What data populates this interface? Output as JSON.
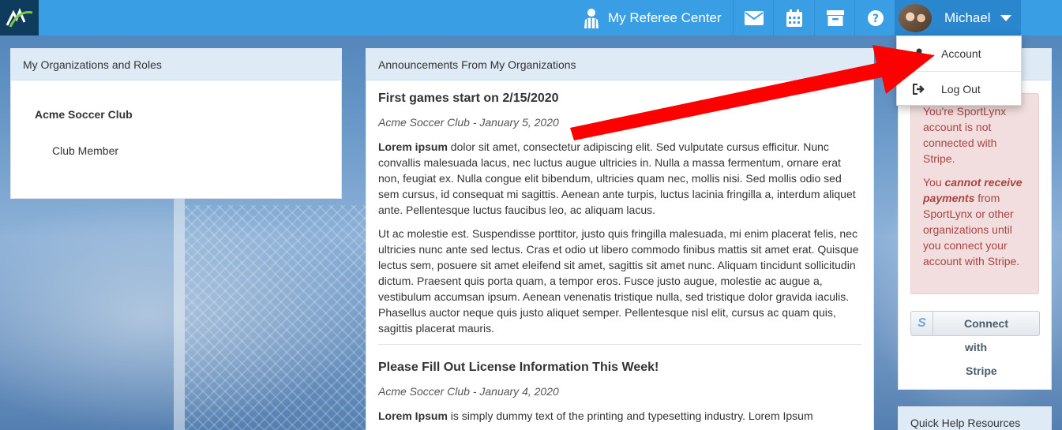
{
  "navbar": {
    "referee_center_label": "My Referee Center",
    "user_name": "Michael"
  },
  "user_menu": {
    "items": [
      {
        "label": "Account",
        "icon": "user-icon"
      },
      {
        "label": "Log Out",
        "icon": "logout-icon"
      }
    ]
  },
  "orgs_panel": {
    "title": "My Organizations and Roles",
    "organizations": [
      {
        "name": "Acme Soccer Club",
        "role": "Club Member"
      }
    ]
  },
  "announcements": {
    "title": "Announcements From My Organizations",
    "items": [
      {
        "title": "First games start on 2/15/2020",
        "meta": "Acme Soccer Club - January 5, 2020",
        "lead_bold": "Lorem ipsum",
        "p1_rest": " dolor sit amet, consectetur adipiscing elit. Sed vulputate cursus efficitur. Nunc convallis malesuada lacus, nec luctus augue ultricies in. Nulla a massa fermentum, ornare erat non, feugiat ex. Nulla congue elit bibendum, ultricies quam nec, mollis nisi. Sed mollis odio sed sem cursus, id consequat mi sagittis. Aenean ante turpis, luctus lacinia fringilla a, interdum aliquet ante. Pellentesque luctus faucibus leo, ac aliquam lacus.",
        "p2": "Ut ac molestie est. Suspendisse porttitor, justo quis fringilla malesuada, mi enim placerat felis, nec ultricies nunc ante sed lectus. Cras et odio ut libero commodo finibus mattis sit amet erat. Quisque lectus sem, posuere sit amet eleifend sit amet, sagittis sit amet nunc. Aliquam tincidunt sollicitudin dictum. Praesent quis porta quam, a tempor eros. Fusce justo augue, molestie ac augue a, vestibulum accumsan ipsum. Aenean venenatis tristique nulla, sed tristique dolor gravida iaculis. Phasellus auctor neque quis justo aliquet semper. Pellentesque nisl elit, cursus ac quam quis, sagittis placerat mauris."
      },
      {
        "title": "Please Fill Out License Information This Week!",
        "meta": "Acme Soccer Club - January 4, 2020",
        "lead_bold": "Lorem Ipsum",
        "p1_rest": " is simply dummy text of the printing and typesetting industry. Lorem Ipsum"
      }
    ]
  },
  "stripe_alert": {
    "line1": "You're SportLynx account is not connected with Stripe.",
    "line2_pre": "You ",
    "line2_emph": "cannot receive payments",
    "line2_post": " from SportLynx or other organizations until you connect your account with Stripe."
  },
  "stripe_button": {
    "word1": "Connect",
    "word2": "with",
    "word3": "Stripe",
    "icon_letter": "S"
  },
  "help_panel": {
    "title": "Quick Help Resources"
  },
  "colors": {
    "navbar": "#3a9ee4",
    "user_menu": "#2a86cd",
    "panel_header": "#deebf7",
    "alert_bg": "#f2dede",
    "alert_text": "#a94442",
    "annotation_arrow": "#ff0000"
  }
}
